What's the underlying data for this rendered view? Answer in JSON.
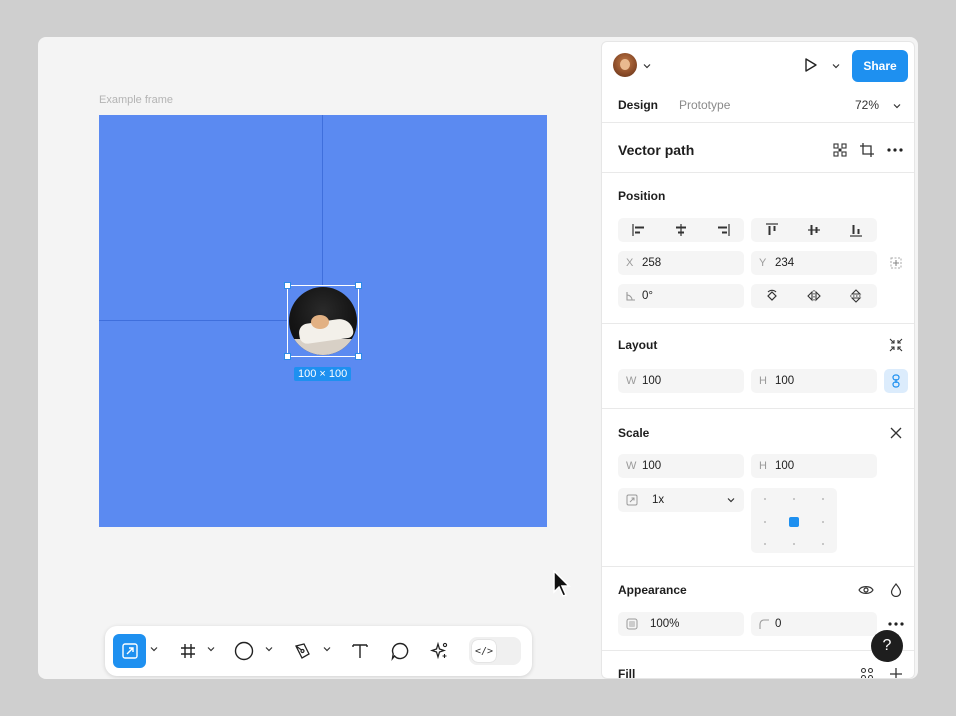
{
  "canvas": {
    "frame_label": "Example frame",
    "frame_color": "#5b8af1",
    "selection_size": "100 × 100"
  },
  "toolbar": {
    "tools": [
      "move-icon",
      "frame-icon",
      "ellipse-icon",
      "pen-icon",
      "text-icon",
      "comment-icon",
      "actions-icon",
      "dev-mode-icon"
    ],
    "dev_mode_label": "</>",
    "accent": "#1e90f0"
  },
  "header": {
    "share_label": "Share",
    "tabs": [
      {
        "label": "Design",
        "active": true
      },
      {
        "label": "Prototype",
        "active": false
      }
    ],
    "zoom": "72%"
  },
  "layer": {
    "title": "Vector path"
  },
  "position": {
    "title": "Position",
    "x_label": "X",
    "x_value": "258",
    "y_label": "Y",
    "y_value": "234",
    "rotation_value": "0°"
  },
  "layout": {
    "title": "Layout",
    "w_label": "W",
    "w_value": "100",
    "h_label": "H",
    "h_value": "100"
  },
  "scale": {
    "title": "Scale",
    "w_label": "W",
    "w_value": "100",
    "h_label": "H",
    "h_value": "100",
    "factor": "1x"
  },
  "appearance": {
    "title": "Appearance",
    "opacity": "100%",
    "corner_radius": "0"
  },
  "fill": {
    "title": "Fill"
  },
  "help_label": "?"
}
